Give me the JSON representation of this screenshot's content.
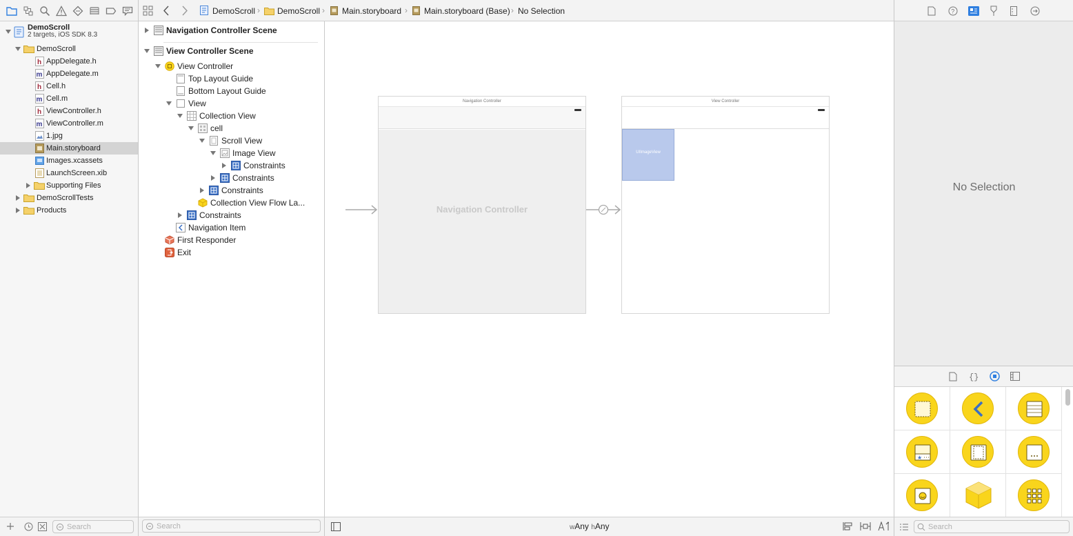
{
  "jumpbar": {
    "items": [
      "DemoScroll",
      "DemoScroll",
      "Main.storyboard",
      "Main.storyboard (Base)",
      "No Selection"
    ]
  },
  "navigator": {
    "project": {
      "name": "DemoScroll",
      "subtitle": "2 targets, iOS SDK 8.3"
    },
    "group": "DemoScroll",
    "files": [
      {
        "label": "AppDelegate.h",
        "kind": "h"
      },
      {
        "label": "AppDelegate.m",
        "kind": "m"
      },
      {
        "label": "Cell.h",
        "kind": "h"
      },
      {
        "label": "Cell.m",
        "kind": "m"
      },
      {
        "label": "ViewController.h",
        "kind": "h"
      },
      {
        "label": "ViewController.m",
        "kind": "m"
      },
      {
        "label": "1.jpg",
        "kind": "image"
      },
      {
        "label": "Main.storyboard",
        "kind": "storyboard",
        "selected": true
      },
      {
        "label": "Images.xcassets",
        "kind": "assets"
      },
      {
        "label": "LaunchScreen.xib",
        "kind": "xib"
      }
    ],
    "supporting_files": "Supporting Files",
    "top_groups": [
      "DemoScrollTests",
      "Products"
    ],
    "filter_placeholder": "Search"
  },
  "outline": {
    "nav_scene": "Navigation Controller Scene",
    "vc_scene": "View Controller Scene",
    "rows": [
      "View Controller",
      "Top Layout Guide",
      "Bottom Layout Guide",
      "View",
      "Collection View",
      "cell",
      "Scroll View",
      "Image View",
      "Constraints",
      "Constraints",
      "Constraints",
      "Collection View Flow La...",
      "Constraints",
      "Navigation Item",
      "First Responder",
      "Exit"
    ],
    "filter_placeholder": "Search"
  },
  "canvas": {
    "nav_controller_title": "Navigation Controller",
    "nav_controller_watermark": "Navigation Controller",
    "view_controller_title": "View Controller",
    "image_view_label": "UIImageView",
    "size_class": {
      "w_prefix": "w",
      "w_value": "Any",
      "h_prefix": "h",
      "h_value": "Any"
    }
  },
  "inspector": {
    "empty_text": "No Selection"
  },
  "library": {
    "filter_placeholder": "Search",
    "items": [
      "view-object-icon",
      "navigation-item-icon",
      "table-view-icon",
      "tab-bar-item-icon",
      "container-view-icon",
      "toolbar-icon",
      "image-view-icon",
      "object-cube-icon",
      "collection-view-icon"
    ]
  },
  "colors": {
    "accent": "#2f7fe0",
    "library_yellow": "#f9d51c",
    "image_view_fill": "#b9c9ec",
    "selection_gray": "#d4d4d4"
  }
}
